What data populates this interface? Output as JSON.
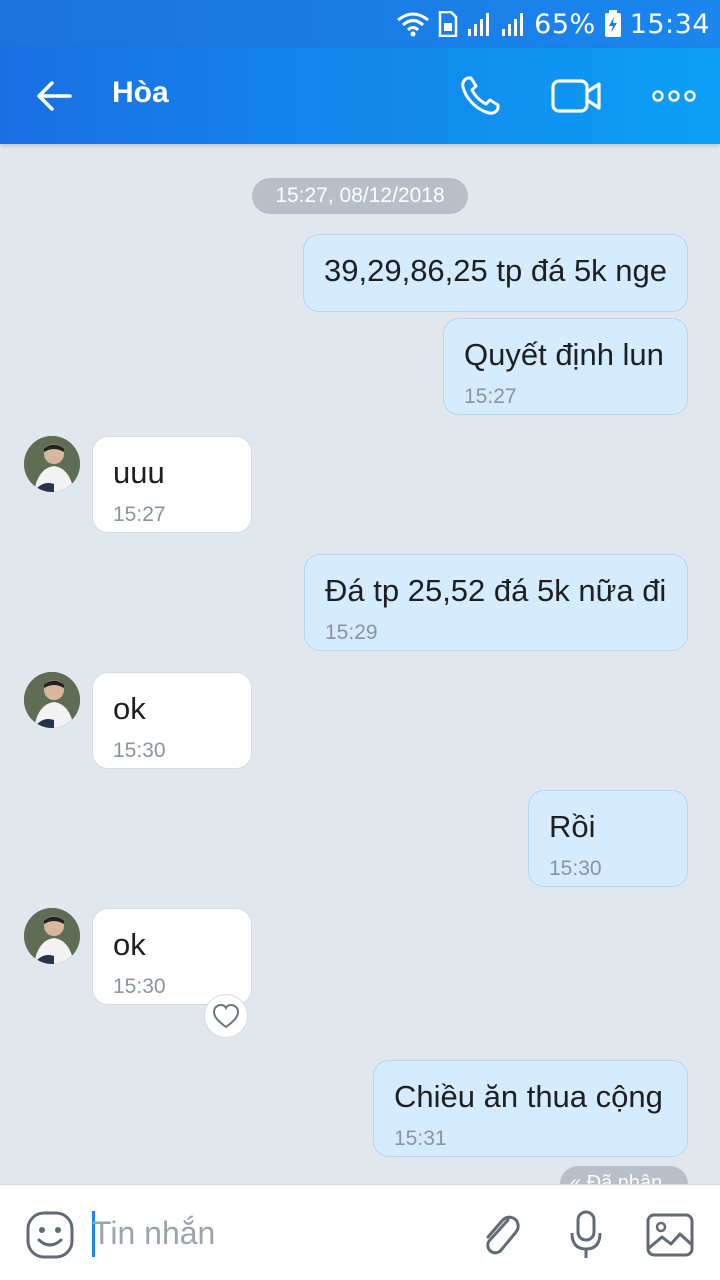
{
  "status_bar": {
    "battery": "65%",
    "time": "15:34"
  },
  "header": {
    "contact_name": "Hòa",
    "icons": [
      "back-arrow-icon",
      "phone-icon",
      "video-call-icon",
      "more-icon"
    ]
  },
  "chat": {
    "date_divider": "15:27, 08/12/2018",
    "messages": [
      {
        "direction": "out",
        "text": "39,29,86,25 tp đá 5k nge",
        "time": ""
      },
      {
        "direction": "out",
        "text": "Quyết định lun",
        "time": "15:27"
      },
      {
        "direction": "in",
        "text": "uuu",
        "time": "15:27"
      },
      {
        "direction": "out",
        "text": "Đá tp 25,52 đá 5k nữa đi",
        "time": "15:29"
      },
      {
        "direction": "in",
        "text": "ok",
        "time": "15:30"
      },
      {
        "direction": "out",
        "text": "Rồi",
        "time": "15:30"
      },
      {
        "direction": "in",
        "text": "ok",
        "time": "15:30"
      },
      {
        "direction": "out",
        "text": "Chiều ăn thua cộng",
        "time": "15:31"
      }
    ],
    "seen_label": "Đã nhận"
  },
  "input_bar": {
    "placeholder": "Tin nhắn",
    "icons": [
      "emoji-icon",
      "attachment-icon",
      "microphone-icon",
      "image-icon"
    ]
  },
  "colors": {
    "header": "#1a86ee",
    "outgoing_bubble": "#d4ecfe",
    "incoming_bubble": "#ffffff",
    "chat_bg": "#e2e7ee"
  }
}
